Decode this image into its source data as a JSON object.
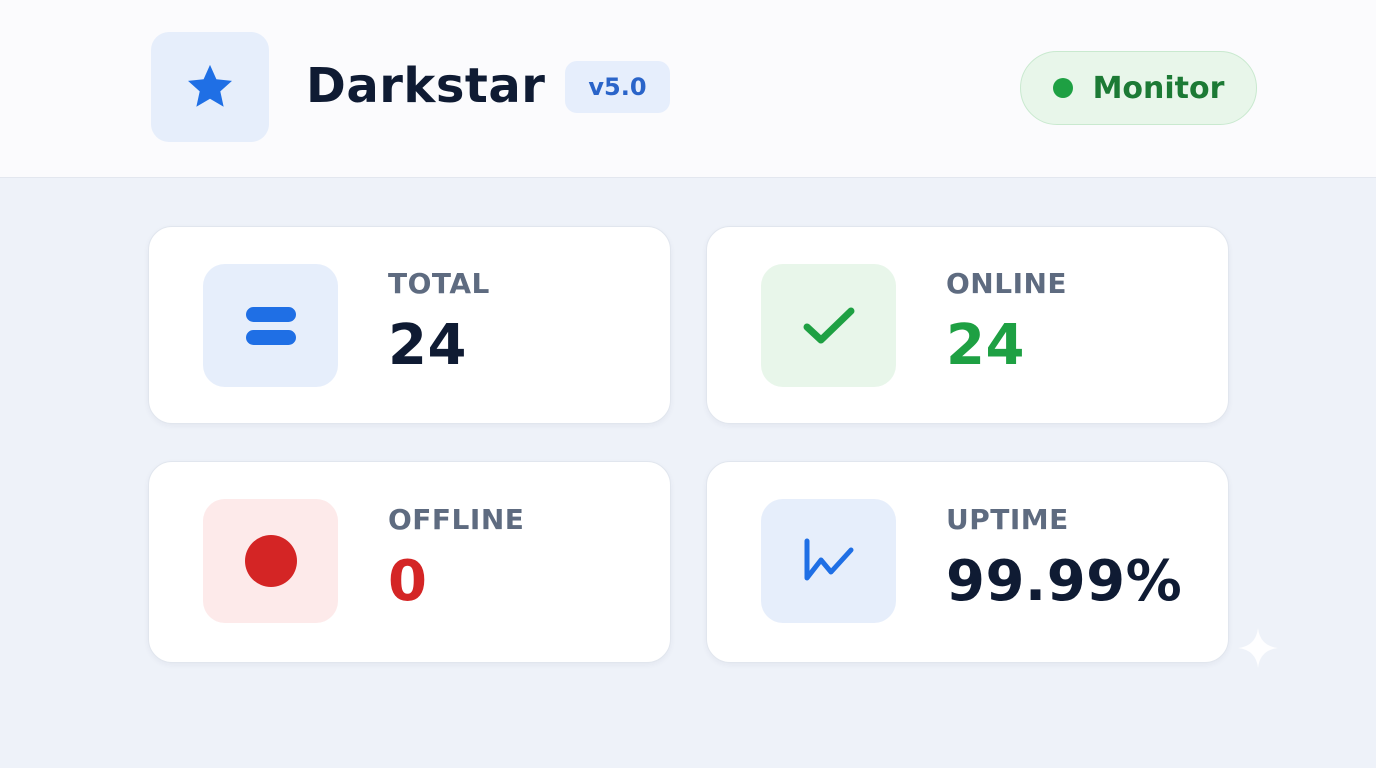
{
  "header": {
    "logo_icon": "star-icon",
    "title": "Darkstar",
    "version": "v5.0",
    "status_label": "Monitor",
    "status_color": "#1ea043"
  },
  "stats": [
    {
      "label": "TOTAL",
      "value": "24",
      "icon": "equals-icon",
      "accent": "#1f6fe5",
      "value_color": "#0f1b33"
    },
    {
      "label": "ONLINE",
      "value": "24",
      "icon": "checkmark-icon",
      "accent": "#1ea043",
      "value_color": "#1ea043"
    },
    {
      "label": "OFFLINE",
      "value": "0",
      "icon": "red-dot-icon",
      "accent": "#d42525",
      "value_color": "#d42525"
    },
    {
      "label": "UPTIME",
      "value": "99.99%",
      "icon": "trend-line-icon",
      "accent": "#1f6fe5",
      "value_color": "#0f1b33"
    }
  ]
}
